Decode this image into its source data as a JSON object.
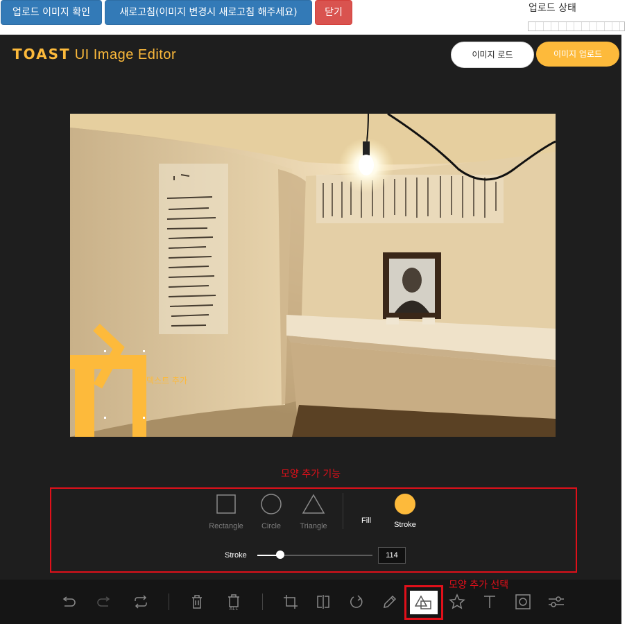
{
  "topbar": {
    "check_button": "업로드 이미지 확인",
    "refresh_button": "새로고침(이미지 변경시 새로고침 해주세요)",
    "close_button": "닫기",
    "upload_status_label": "업로드 상태"
  },
  "header": {
    "logo_brand": "TOAST",
    "logo_product": " UI Image Editor",
    "load_button": "이미지 로드",
    "upload_button": "이미지 업로드"
  },
  "canvas": {
    "text_object": "텍스트 추가",
    "shape_color": "#fdba3b"
  },
  "shape_panel": {
    "section_label": "모양 추가 기능",
    "shapes": [
      {
        "label": "Rectangle",
        "icon": "rectangle-icon"
      },
      {
        "label": "Circle",
        "icon": "circle-icon"
      },
      {
        "label": "Triangle",
        "icon": "triangle-icon"
      }
    ],
    "fill_label": "Fill",
    "stroke_label": "Stroke",
    "stroke_color": "#fdba3b",
    "stroke_width_label": "Stroke",
    "stroke_width_value": "114",
    "stroke_width_fraction": 0.2
  },
  "toolbar": {
    "selected_label": "모양 추가 선택",
    "active_tool": "shape",
    "tools": [
      "undo-icon",
      "redo-icon",
      "reset-icon",
      "delete-icon",
      "delete-all-icon",
      "crop-icon",
      "flip-icon",
      "rotate-icon",
      "draw-icon",
      "shape-icon",
      "icon-star",
      "text-icon",
      "mask-icon",
      "filter-icon"
    ]
  },
  "colors": {
    "accent": "#fdba3b",
    "highlight": "#e0101a",
    "editor_bg": "#1e1e1e"
  }
}
